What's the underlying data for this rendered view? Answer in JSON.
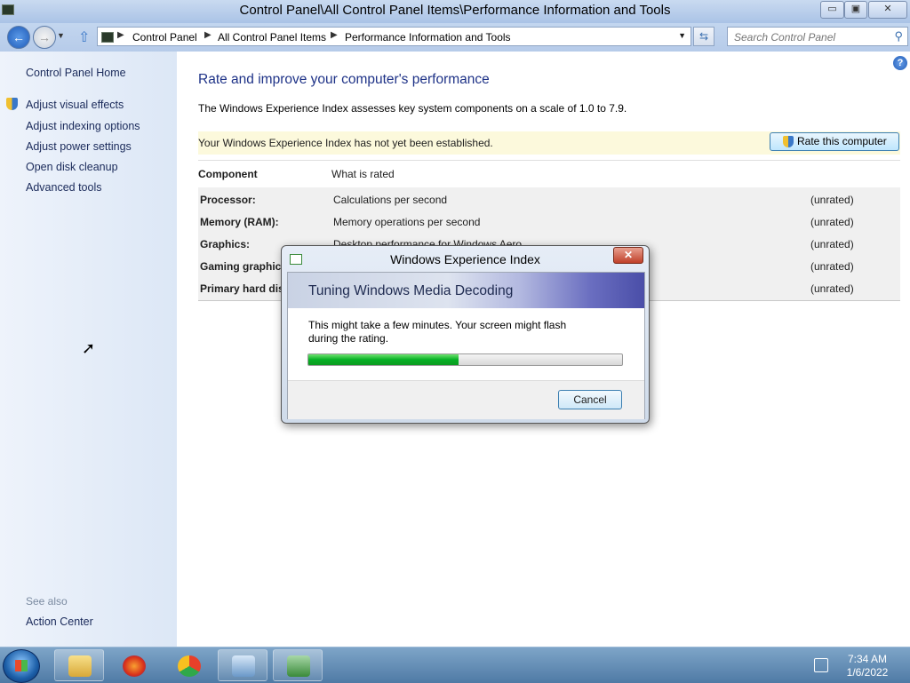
{
  "window": {
    "title": "Control Panel\\All Control Panel Items\\Performance Information and Tools",
    "minimize_label": "▭",
    "restore_label": "▣",
    "close_label": "✕"
  },
  "address_bar": {
    "crumbs": [
      "Control Panel",
      "All Control Panel Items",
      "Performance Information and Tools"
    ],
    "separator": "▶"
  },
  "search": {
    "placeholder": "Search Control Panel",
    "value": ""
  },
  "left_pane": {
    "home": "Control Panel Home",
    "links": [
      "Adjust visual effects",
      "Adjust indexing options",
      "Adjust power settings",
      "Open disk cleanup",
      "Advanced tools"
    ],
    "see_also_title": "See also",
    "see_also_links": [
      "Action Center"
    ]
  },
  "main": {
    "heading": "Rate and improve your computer's performance",
    "description": "The Windows Experience Index assesses key system components on a scale of 1.0 to 7.9.",
    "banner": "Your Windows Experience Index has not yet been established.",
    "rate_button": "Rate this computer",
    "help_label": "?",
    "table": {
      "headers": [
        "Component",
        "What is rated"
      ],
      "rows": [
        {
          "component": "Processor:",
          "rated": "Calculations per second",
          "score": "(unrated)"
        },
        {
          "component": "Memory (RAM):",
          "rated": "Memory operations per second",
          "score": "(unrated)"
        },
        {
          "component": "Graphics:",
          "rated": "Desktop performance for Windows Aero",
          "score": "(unrated)"
        },
        {
          "component": "Gaming graphics",
          "rated": "",
          "score": "(unrated)"
        },
        {
          "component": "Primary hard disk",
          "rated": "",
          "score": "(unrated)"
        }
      ]
    }
  },
  "dialog": {
    "title": "Windows Experience Index",
    "close_label": "✕",
    "header": "Tuning Windows Media Decoding",
    "message": "This might take a few minutes. Your screen might flash during the rating.",
    "progress_percent": 48,
    "cancel_button": "Cancel"
  },
  "taskbar": {
    "apps": [
      "file-explorer-icon",
      "firefox-icon",
      "chrome-icon",
      "control-panel-icon",
      "winsat-icon"
    ],
    "time": "7:34 AM",
    "date": "1/6/2022"
  }
}
